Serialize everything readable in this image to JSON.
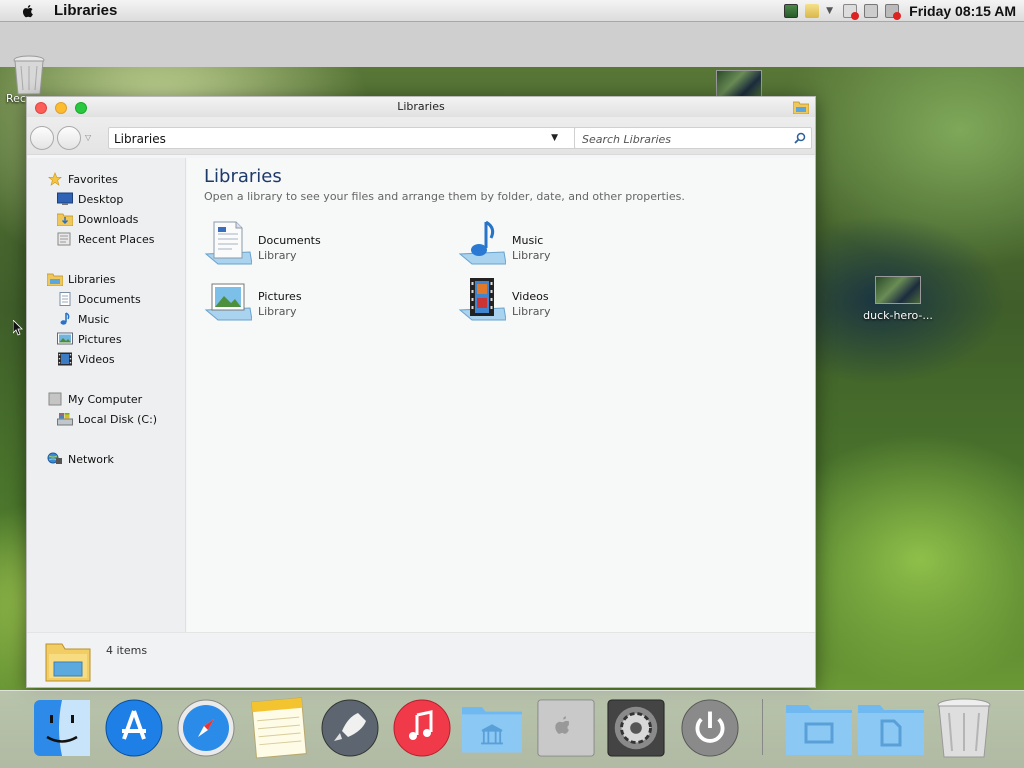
{
  "menubar": {
    "app_name": "Libraries",
    "clock": "Friday 08:15 AM"
  },
  "desktop": {
    "partial_icon_label": "Rec",
    "file_label": "duck-hero-..."
  },
  "window": {
    "title": "Libraries",
    "address": "Libraries",
    "search_placeholder": "Search Libraries"
  },
  "sidebar": {
    "favorites": {
      "label": "Favorites",
      "items": [
        "Desktop",
        "Downloads",
        "Recent Places"
      ]
    },
    "libraries": {
      "label": "Libraries",
      "items": [
        "Documents",
        "Music",
        "Pictures",
        "Videos"
      ]
    },
    "computer": {
      "label": "My Computer",
      "items": [
        "Local Disk (C:)"
      ]
    },
    "network": {
      "label": "Network"
    }
  },
  "content": {
    "title": "Libraries",
    "subtitle": "Open a library to see your files and arrange them by folder, date, and other properties.",
    "libraries": [
      {
        "name": "Documents",
        "type": "Library",
        "icon": "documents-library-icon"
      },
      {
        "name": "Music",
        "type": "Library",
        "icon": "music-library-icon"
      },
      {
        "name": "Pictures",
        "type": "Library",
        "icon": "pictures-library-icon"
      },
      {
        "name": "Videos",
        "type": "Library",
        "icon": "videos-library-icon"
      }
    ]
  },
  "status": {
    "count": "4 items"
  },
  "dock": {
    "apps": [
      "finder-icon",
      "app-store-icon",
      "safari-icon",
      "notes-icon",
      "launchpad-icon",
      "itunes-icon",
      "libraries-folder-icon",
      "mac-pro-icon",
      "system-preferences-icon",
      "power-icon",
      "documents-folder-icon",
      "files-folder-icon",
      "trash-icon"
    ]
  }
}
